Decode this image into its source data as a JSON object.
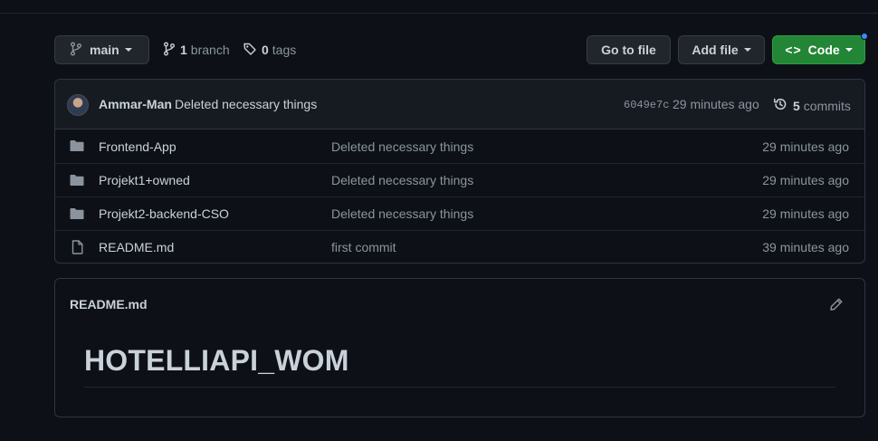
{
  "toolbar": {
    "branch_name": "main",
    "branches_count": "1",
    "branches_label": "branch",
    "tags_count": "0",
    "tags_label": "tags",
    "goto_label": "Go to file",
    "addfile_label": "Add file",
    "code_label": "Code"
  },
  "commit": {
    "author": "Ammar-Man",
    "message": "Deleted necessary things",
    "sha": "6049e7c",
    "time": "29 minutes ago",
    "commits_count": "5",
    "commits_label": "commits"
  },
  "files": [
    {
      "name": "Frontend-App",
      "type": "folder",
      "message": "Deleted necessary things",
      "time": "29 minutes ago"
    },
    {
      "name": "Projekt1+owned",
      "type": "folder",
      "message": "Deleted necessary things",
      "time": "29 minutes ago"
    },
    {
      "name": "Projekt2-backend-CSO",
      "type": "folder",
      "message": "Deleted necessary things",
      "time": "29 minutes ago"
    },
    {
      "name": "README.md",
      "type": "file",
      "message": "first commit",
      "time": "39 minutes ago"
    }
  ],
  "readme": {
    "title": "README.md",
    "heading": "HOTELLIAPI_WOM"
  },
  "colors": {
    "background": "#0d1117",
    "code_button": "#238636",
    "notification_dot": "#388bfd"
  },
  "icons": {
    "branch": "git-branch-icon",
    "tag": "tag-icon",
    "history": "history-icon",
    "folder": "folder-icon",
    "file": "file-icon",
    "pencil": "pencil-icon",
    "code": "code-icon"
  }
}
